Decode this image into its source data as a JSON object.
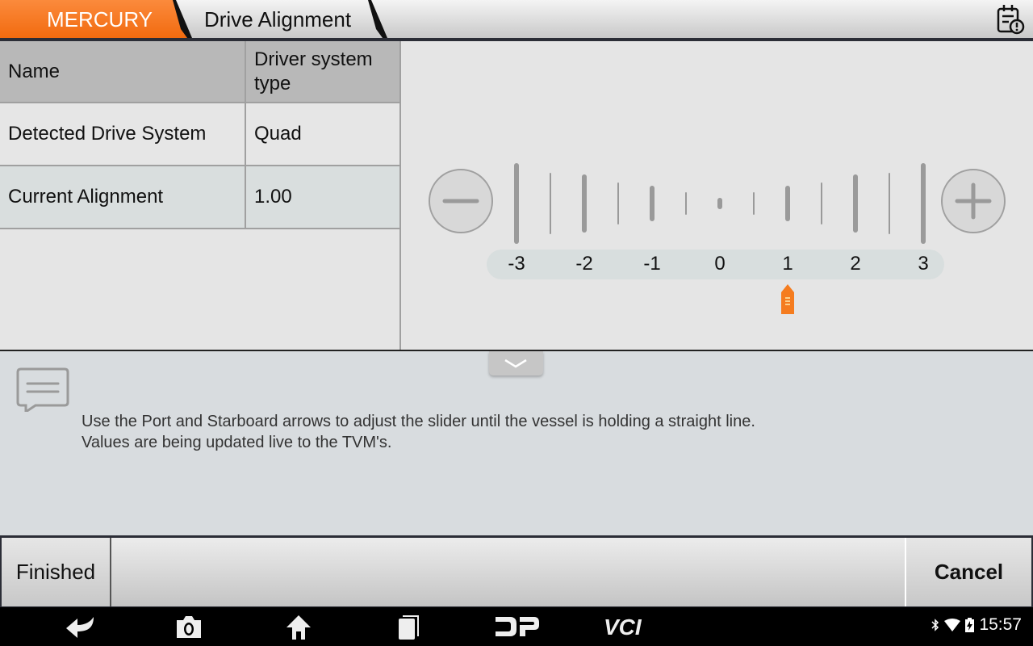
{
  "header": {
    "brand": "MERCURY",
    "page_title": "Drive Alignment",
    "report_icon": "calendar-alert-icon"
  },
  "table": {
    "columns": [
      "Name",
      "Driver system type"
    ],
    "rows": [
      {
        "name": "Detected Drive System",
        "value": "Quad"
      },
      {
        "name": "Current Alignment",
        "value": "1.00"
      }
    ]
  },
  "slider": {
    "decrease_icon": "minus-icon",
    "increase_icon": "plus-icon",
    "tick_labels": [
      "-3",
      "-2",
      "-1",
      "0",
      "1",
      "2",
      "3"
    ],
    "min": -3,
    "max": 3,
    "value": 1.0,
    "thumb_color": "#f57c1f"
  },
  "message": {
    "icon": "chat-message-icon",
    "collapse_icon": "chevron-down-icon",
    "line1": "Use the Port and Starboard arrows to adjust the slider until the vessel is holding a straight line.",
    "line2": "Values are being updated live to the TVM's."
  },
  "footer": {
    "finished_label": "Finished",
    "cancel_label": "Cancel"
  },
  "navbar": {
    "icons": [
      "back-icon",
      "screenshot-camera-icon",
      "home-icon",
      "recent-apps-icon",
      "dp-logo-icon",
      "vci-logo-icon"
    ],
    "vci_label": "VCI",
    "time": "15:57"
  },
  "colors": {
    "brand_orange": "#f57c1f",
    "header_dark": "#2b2d36"
  }
}
